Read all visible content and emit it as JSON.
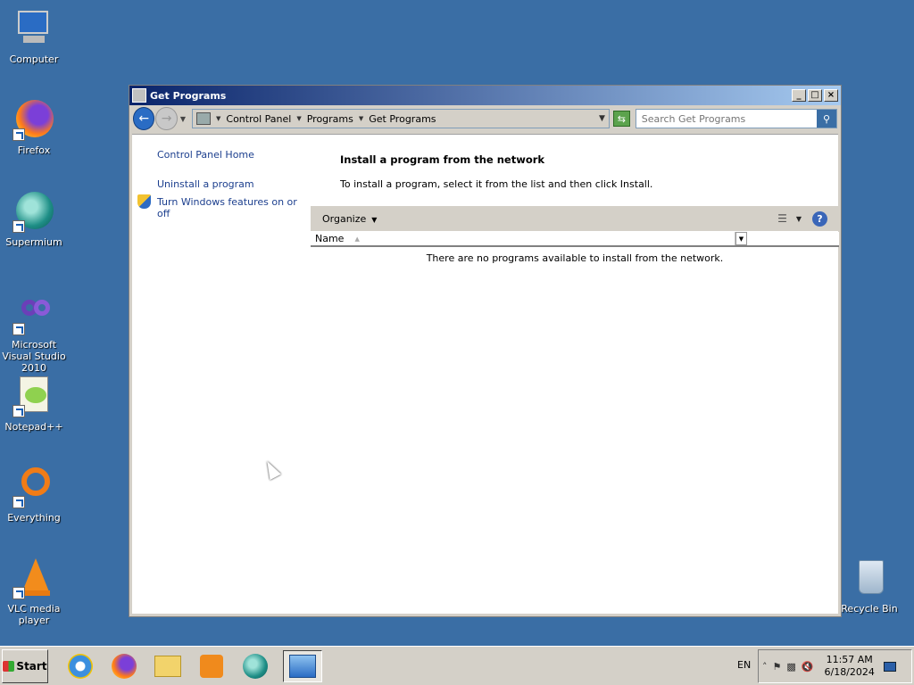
{
  "desktop": {
    "icons": [
      {
        "label": "Computer",
        "icon": "computer-icon"
      },
      {
        "label": "Firefox",
        "icon": "firefox-icon"
      },
      {
        "label": "Supermium",
        "icon": "supermium-icon"
      },
      {
        "label": "Microsoft Visual Studio 2010",
        "icon": "visual-studio-icon"
      },
      {
        "label": "Notepad++",
        "icon": "notepad-plus-plus-icon"
      },
      {
        "label": "Everything",
        "icon": "everything-icon"
      },
      {
        "label": "VLC media player",
        "icon": "vlc-icon"
      }
    ],
    "recycle_bin": {
      "label": "Recycle Bin",
      "icon": "recycle-bin-icon"
    }
  },
  "window": {
    "title": "Get Programs",
    "controls": {
      "minimize": "_",
      "maximize": "□",
      "close": "×"
    },
    "breadcrumb": [
      "Control Panel",
      "Programs",
      "Get Programs"
    ],
    "search": {
      "placeholder": "Search Get Programs"
    },
    "left_pane": {
      "home": "Control Panel Home",
      "uninstall": "Uninstall a program",
      "features": "Turn Windows features on or off"
    },
    "main": {
      "title": "Install a program from the network",
      "description": "To install a program, select it from the list and then click Install.",
      "organize": "Organize",
      "column_name": "Name",
      "empty_message": "There are no programs available to install from the network."
    }
  },
  "taskbar": {
    "start_label": "Start",
    "apps": [
      "internet-explorer-icon",
      "firefox-icon",
      "file-explorer-icon",
      "media-player-icon",
      "supermium-icon",
      "control-panel-icon"
    ],
    "language": "EN",
    "time": "11:57 AM",
    "date": "6/18/2024"
  },
  "colors": {
    "desktop_bg": "#3a6ea5",
    "title_gradient_start": "#0a246a",
    "title_gradient_end": "#a6caf0",
    "link": "#1c3f8e"
  }
}
